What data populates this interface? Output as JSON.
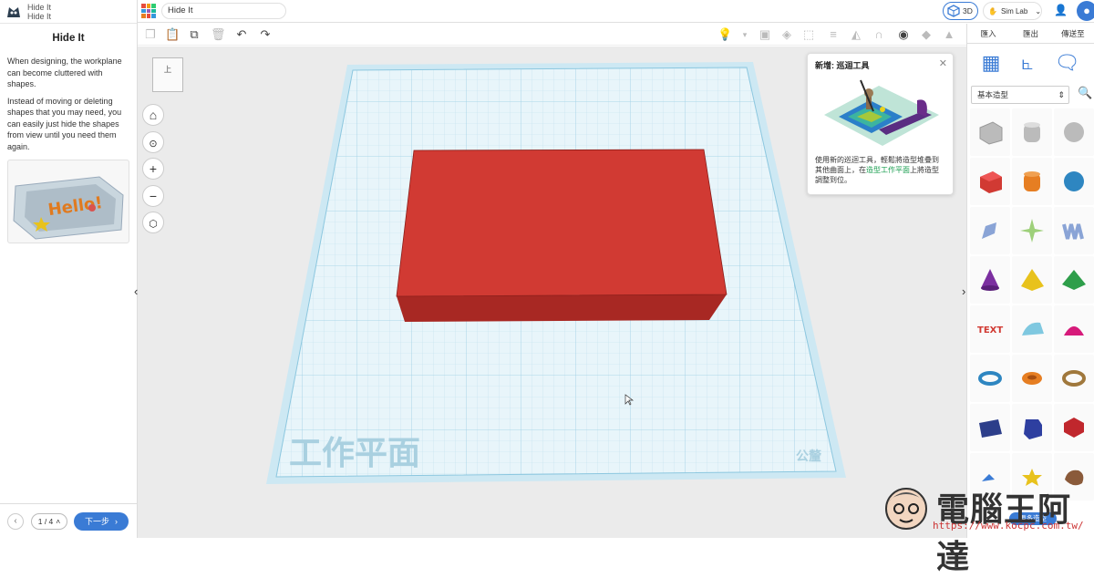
{
  "left_panel": {
    "header_title": "Hide It",
    "header_subtitle": "Hide It",
    "lesson_title": "Hide It",
    "paragraphs": [
      "When designing, the workplane can become cluttered with shapes.",
      "Instead of moving or deleting shapes that you may need, you can easily just hide the shapes from view until you need them again."
    ],
    "pager": "1 / 4",
    "next_label": "下一步"
  },
  "topbar": {
    "doc_title": "Hide It",
    "view_label": "3D",
    "simlab_label": "Sim Lab"
  },
  "right_panel": {
    "tabs": [
      "匯入",
      "匯出",
      "傳送至"
    ],
    "category": "基本造型",
    "more_shapes": "更多造型"
  },
  "workplane": {
    "label_main": "工作平面",
    "label_unit": "公釐",
    "viewcube_face": "上"
  },
  "tooltip": {
    "title": "新增: 巡迴工具",
    "text_before": "使用新的巡迴工具，輕鬆將造型堆疊到其他曲面上，在",
    "text_link": "造型工作平面",
    "text_after": "上將造型調整到位。"
  },
  "watermark": {
    "title": "電腦王阿達",
    "url": "https://www.kocpc.com.tw/"
  },
  "colors": {
    "accent": "#3a7bd5",
    "box": "#d13a33",
    "grid": "#d9eef6"
  }
}
